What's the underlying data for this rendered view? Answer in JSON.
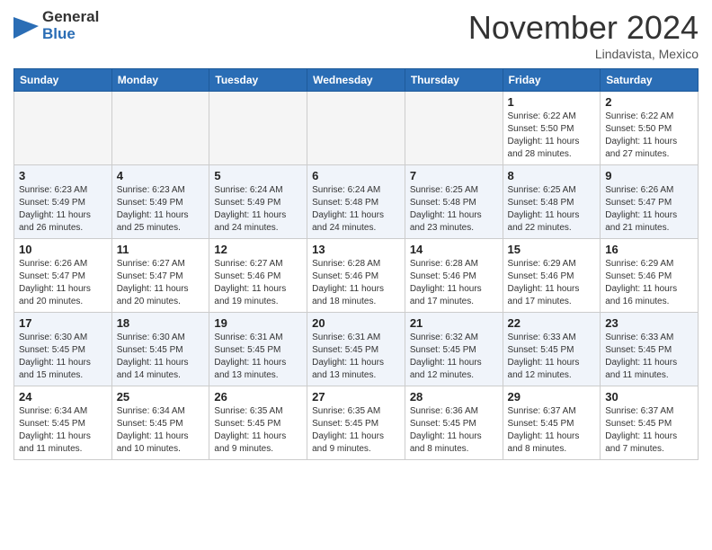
{
  "header": {
    "logo_general": "General",
    "logo_blue": "Blue",
    "month_title": "November 2024",
    "location": "Lindavista, Mexico"
  },
  "weekdays": [
    "Sunday",
    "Monday",
    "Tuesday",
    "Wednesday",
    "Thursday",
    "Friday",
    "Saturday"
  ],
  "weeks": [
    [
      {
        "day": null
      },
      {
        "day": null
      },
      {
        "day": null
      },
      {
        "day": null
      },
      {
        "day": null
      },
      {
        "day": 1,
        "sunrise": "6:22 AM",
        "sunset": "5:50 PM",
        "daylight": "11 hours and 28 minutes."
      },
      {
        "day": 2,
        "sunrise": "6:22 AM",
        "sunset": "5:50 PM",
        "daylight": "11 hours and 27 minutes."
      }
    ],
    [
      {
        "day": 3,
        "sunrise": "6:23 AM",
        "sunset": "5:49 PM",
        "daylight": "11 hours and 26 minutes."
      },
      {
        "day": 4,
        "sunrise": "6:23 AM",
        "sunset": "5:49 PM",
        "daylight": "11 hours and 25 minutes."
      },
      {
        "day": 5,
        "sunrise": "6:24 AM",
        "sunset": "5:49 PM",
        "daylight": "11 hours and 24 minutes."
      },
      {
        "day": 6,
        "sunrise": "6:24 AM",
        "sunset": "5:48 PM",
        "daylight": "11 hours and 24 minutes."
      },
      {
        "day": 7,
        "sunrise": "6:25 AM",
        "sunset": "5:48 PM",
        "daylight": "11 hours and 23 minutes."
      },
      {
        "day": 8,
        "sunrise": "6:25 AM",
        "sunset": "5:48 PM",
        "daylight": "11 hours and 22 minutes."
      },
      {
        "day": 9,
        "sunrise": "6:26 AM",
        "sunset": "5:47 PM",
        "daylight": "11 hours and 21 minutes."
      }
    ],
    [
      {
        "day": 10,
        "sunrise": "6:26 AM",
        "sunset": "5:47 PM",
        "daylight": "11 hours and 20 minutes."
      },
      {
        "day": 11,
        "sunrise": "6:27 AM",
        "sunset": "5:47 PM",
        "daylight": "11 hours and 20 minutes."
      },
      {
        "day": 12,
        "sunrise": "6:27 AM",
        "sunset": "5:46 PM",
        "daylight": "11 hours and 19 minutes."
      },
      {
        "day": 13,
        "sunrise": "6:28 AM",
        "sunset": "5:46 PM",
        "daylight": "11 hours and 18 minutes."
      },
      {
        "day": 14,
        "sunrise": "6:28 AM",
        "sunset": "5:46 PM",
        "daylight": "11 hours and 17 minutes."
      },
      {
        "day": 15,
        "sunrise": "6:29 AM",
        "sunset": "5:46 PM",
        "daylight": "11 hours and 17 minutes."
      },
      {
        "day": 16,
        "sunrise": "6:29 AM",
        "sunset": "5:46 PM",
        "daylight": "11 hours and 16 minutes."
      }
    ],
    [
      {
        "day": 17,
        "sunrise": "6:30 AM",
        "sunset": "5:45 PM",
        "daylight": "11 hours and 15 minutes."
      },
      {
        "day": 18,
        "sunrise": "6:30 AM",
        "sunset": "5:45 PM",
        "daylight": "11 hours and 14 minutes."
      },
      {
        "day": 19,
        "sunrise": "6:31 AM",
        "sunset": "5:45 PM",
        "daylight": "11 hours and 13 minutes."
      },
      {
        "day": 20,
        "sunrise": "6:31 AM",
        "sunset": "5:45 PM",
        "daylight": "11 hours and 13 minutes."
      },
      {
        "day": 21,
        "sunrise": "6:32 AM",
        "sunset": "5:45 PM",
        "daylight": "11 hours and 12 minutes."
      },
      {
        "day": 22,
        "sunrise": "6:33 AM",
        "sunset": "5:45 PM",
        "daylight": "11 hours and 12 minutes."
      },
      {
        "day": 23,
        "sunrise": "6:33 AM",
        "sunset": "5:45 PM",
        "daylight": "11 hours and 11 minutes."
      }
    ],
    [
      {
        "day": 24,
        "sunrise": "6:34 AM",
        "sunset": "5:45 PM",
        "daylight": "11 hours and 11 minutes."
      },
      {
        "day": 25,
        "sunrise": "6:34 AM",
        "sunset": "5:45 PM",
        "daylight": "11 hours and 10 minutes."
      },
      {
        "day": 26,
        "sunrise": "6:35 AM",
        "sunset": "5:45 PM",
        "daylight": "11 hours and 9 minutes."
      },
      {
        "day": 27,
        "sunrise": "6:35 AM",
        "sunset": "5:45 PM",
        "daylight": "11 hours and 9 minutes."
      },
      {
        "day": 28,
        "sunrise": "6:36 AM",
        "sunset": "5:45 PM",
        "daylight": "11 hours and 8 minutes."
      },
      {
        "day": 29,
        "sunrise": "6:37 AM",
        "sunset": "5:45 PM",
        "daylight": "11 hours and 8 minutes."
      },
      {
        "day": 30,
        "sunrise": "6:37 AM",
        "sunset": "5:45 PM",
        "daylight": "11 hours and 7 minutes."
      }
    ]
  ],
  "labels": {
    "sunrise": "Sunrise:",
    "sunset": "Sunset:",
    "daylight": "Daylight:"
  },
  "colors": {
    "header_bg": "#2a6db5",
    "logo_blue": "#2a6db5"
  }
}
